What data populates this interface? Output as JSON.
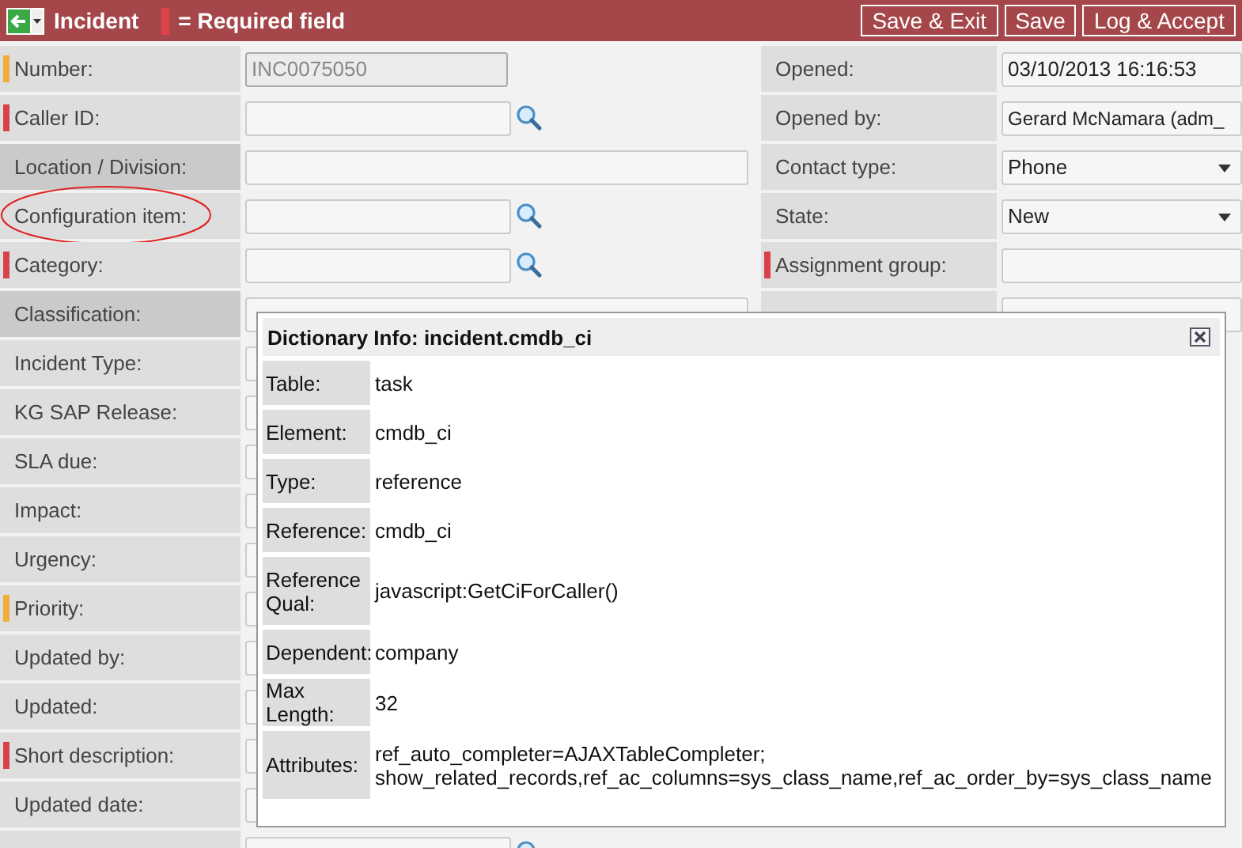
{
  "header": {
    "title": "Incident",
    "legend": "= Required field",
    "buttons": [
      "Save & Exit",
      "Save",
      "Log & Accept"
    ]
  },
  "left_fields": [
    {
      "label": "Number:",
      "color": "#f0ad3a",
      "kind": "readonly",
      "disabled": true,
      "value": "INC0075050"
    },
    {
      "label": "Caller ID:",
      "color": "#d9414a",
      "kind": "reference"
    },
    {
      "label": "Location / Division:",
      "kind": "wide",
      "shaded": true
    },
    {
      "label": "Configuration item:",
      "kind": "reference",
      "circled": true
    },
    {
      "label": "Category:",
      "color": "#d9414a",
      "kind": "reference"
    },
    {
      "label": "Classification:",
      "kind": "wide",
      "shaded": true
    },
    {
      "label": "Incident Type:",
      "kind": "wide"
    },
    {
      "label": "KG SAP Release:",
      "kind": "wide"
    },
    {
      "label": "SLA due:",
      "kind": "wide"
    },
    {
      "label": "Impact:",
      "kind": "wide"
    },
    {
      "label": "Urgency:",
      "kind": "wide"
    },
    {
      "label": "Priority:",
      "color": "#f0ad3a",
      "kind": "wide"
    },
    {
      "label": "Updated by:",
      "kind": "wide"
    },
    {
      "label": "Updated:",
      "kind": "wide"
    },
    {
      "label": "Short description:",
      "color": "#d9414a",
      "kind": "wide"
    },
    {
      "label": "Updated date:",
      "kind": "wide"
    },
    {
      "kind": "reference"
    }
  ],
  "right_fields": [
    {
      "label": "Opened:",
      "kind": "text",
      "value": "03/10/2013 16:16:53"
    },
    {
      "label": "Opened by:",
      "kind": "text",
      "value": "Gerard McNamara (adm_"
    },
    {
      "label": "Contact type:",
      "kind": "select",
      "value": "Phone"
    },
    {
      "label": "State:",
      "kind": "select",
      "value": "New"
    },
    {
      "label": "Assignment group:",
      "color": "#d9414a",
      "kind": "text"
    },
    {
      "kind": "text"
    }
  ],
  "dialog": {
    "title": "Dictionary Info: incident.cmdb_ci",
    "rows": [
      {
        "label": "Table:",
        "value": "task"
      },
      {
        "label": "Element:",
        "value": "cmdb_ci"
      },
      {
        "label": "Type:",
        "value": "reference"
      },
      {
        "label": "Reference:",
        "value": "cmdb_ci"
      },
      {
        "label": "Reference Qual:",
        "value": "javascript:GetCiForCaller()"
      },
      {
        "label": "Dependent:",
        "value": "company"
      },
      {
        "label": "Max Length:",
        "value": "32"
      },
      {
        "label": "Attributes:",
        "value": "ref_auto_completer=AJAXTableCompleter; show_related_records,ref_ac_columns=sys_class_name,ref_ac_order_by=sys_class_name"
      }
    ]
  }
}
